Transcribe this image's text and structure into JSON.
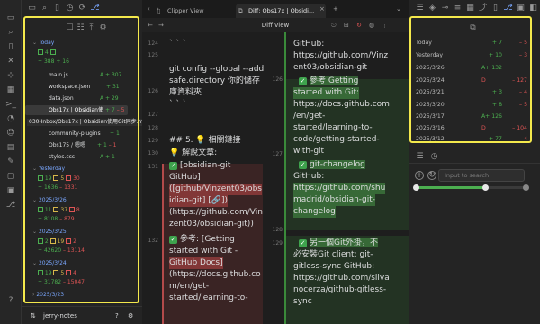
{
  "ribbon": {
    "icons": [
      "files-icon",
      "search-icon",
      "bookmark-icon",
      "shuffle-icon",
      "graph-icon",
      "calendar-icon",
      "command-icon",
      "tag-icon",
      "sync-icon",
      "smiley-icon",
      "publish-icon",
      "pen-icon",
      "template-icon",
      "terminal-icon",
      "git-icon"
    ]
  },
  "git_panel": {
    "today": {
      "label": "Today",
      "changes": "4",
      "files": "388",
      "add": "16"
    },
    "today_files": [
      {
        "name": "main.js",
        "status": "A",
        "count": "307"
      },
      {
        "name": "workspace.json",
        "status": "+",
        "count": "31"
      },
      {
        "name": "data.json",
        "status": "A",
        "count": "29"
      },
      {
        "name": "Obs17x | Obsidian使",
        "status": "+",
        "count": "7",
        "del": "5"
      }
    ],
    "tooltip": "030-Inbox/Obs17x | Obsidian使用Git同步.md",
    "more_files": [
      {
        "name": "community-plugins",
        "status": "+",
        "count": "1"
      },
      {
        "name": "Obs175 / 嗯嗯",
        "status": "+",
        "count": "1",
        "del": "1"
      },
      {
        "name": "styles.css",
        "status": "A",
        "count": "1"
      }
    ],
    "yesterday": {
      "label": "Yesterday",
      "a": "19",
      "b": "5",
      "c": "30",
      "plus": "1636",
      "minus": "1331"
    },
    "d0326": {
      "label": "2025/3/26",
      "a": "11",
      "b": "37",
      "c": "8",
      "plus": "8108",
      "minus": "879"
    },
    "d0325": {
      "label": "2025/3/25",
      "a": "2",
      "b": "19",
      "c": "2",
      "plus": "42620",
      "minus": "13114"
    },
    "d0324": {
      "label": "2025/3/24",
      "a": "19",
      "b": "5",
      "c": "4",
      "plus": "31782",
      "minus": "15047"
    },
    "d0323": {
      "label": "2025/3/23"
    }
  },
  "footer": {
    "vault": "jerry-notes"
  },
  "tabs": {
    "clipper": "Clipper View",
    "diff": "Diff: Obs17x | Obsidi..."
  },
  "view": {
    "title": "Diff view"
  },
  "diff_left": {
    "line_nums": [
      "124",
      "125",
      "126",
      "127",
      "128",
      "129",
      "130",
      "131",
      "132"
    ],
    "lines": [
      "` ` `",
      "git config --global --add",
      "safe.directory 你的儲存",
      "庫資料夾",
      "` ` `",
      "",
      "## 5. 💡 相關鏈接",
      "💡 解說文章:",
      "[obsidian-git",
      "GitHub]",
      "([github/Vinzent03/obs",
      "idian-git] [🔗])",
      "(https://github.com/Vin",
      "zent03/obsidian-git))",
      "參考: [Getting",
      "started with Git -",
      "GitHub Docs]",
      "(https://docs.github.co",
      "m/en/get-",
      "started/learning-to-"
    ]
  },
  "diff_right": {
    "line_nums": [
      "126",
      "127",
      "128",
      "129"
    ],
    "lines": [
      "GitHub:",
      "https://github.com/Vinz",
      "ent03/obsidian-git",
      "參考 Getting",
      "started with Git:",
      "https://docs.github.com",
      "/en/get-",
      "started/learning-to-",
      "code/getting-started-",
      "with-git",
      "git-changelog",
      "GitHub:",
      "https://github.com/shu",
      "madrid/obsidian-git-",
      "changelog",
      "",
      "另一個Git外掛，不",
      "必安裝Git client: git-",
      "gitless-sync GitHub:",
      "https://github.com/silva",
      "nocerza/github-gitless-",
      "sync"
    ]
  },
  "history": [
    {
      "date": "Today",
      "add": "",
      "plus": "7",
      "minus": "5"
    },
    {
      "date": "Yesterday",
      "add": "",
      "plus": "10",
      "minus": "3"
    },
    {
      "date": "2025/3/26",
      "add": "A",
      "plus": "132",
      "minus": ""
    },
    {
      "date": "2025/3/24",
      "add": "D",
      "plus": "",
      "minus": "127"
    },
    {
      "date": "2025/3/21",
      "add": "",
      "plus": "3",
      "minus": "4"
    },
    {
      "date": "2025/3/20",
      "add": "",
      "plus": "8",
      "minus": "5"
    },
    {
      "date": "2025/3/17",
      "add": "A",
      "plus": "126",
      "minus": ""
    },
    {
      "date": "2025/3/16",
      "add": "D",
      "plus": "",
      "minus": "104"
    },
    {
      "date": "2025/3/12",
      "add": "",
      "plus": "77",
      "minus": "4"
    }
  ],
  "search": {
    "placeholder": "Input to search"
  },
  "slider": {
    "value_fraction": 0.62
  },
  "colors": {
    "highlight": "#f4e94c",
    "add": "#4caf50",
    "del": "#e05555",
    "link": "#7aa7ff"
  }
}
